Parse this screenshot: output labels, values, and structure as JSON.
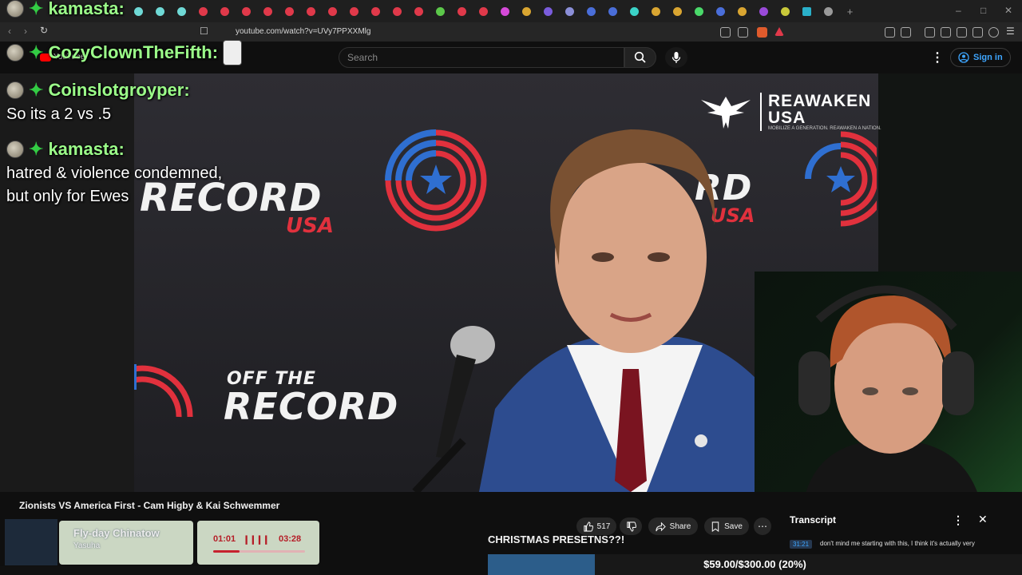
{
  "browser": {
    "url": "youtube.com/watch?v=UVy7PPXXMlg"
  },
  "youtube": {
    "logo_text": "YouTube",
    "search_placeholder": "Search",
    "sign_in_label": "Sign in"
  },
  "video": {
    "title": "Zionists VS America First - Cam Higby & Kai Schwemmer",
    "backdrop_word": "RECORD",
    "backdrop_word_right": "RD",
    "backdrop_usa": "USA",
    "off_the": "OFF THE",
    "off_record": "RECORD",
    "sponsor_name": "REAWAKEN",
    "sponsor_usa": "USA",
    "sponsor_tagline": "MOBILIZE A GENERATION. REAWAKEN A NATION."
  },
  "chat": [
    {
      "user": "kamasta:",
      "message": ""
    },
    {
      "user": "CozyClownTheFifth:",
      "message": ""
    },
    {
      "user": "Coinslotgroyper:",
      "message": "So its a 2 vs .5"
    },
    {
      "user": "kamasta:",
      "message_lines": [
        "hatred & violence condemned,",
        "but only for Ewes"
      ]
    }
  ],
  "actions": {
    "like_count": "517",
    "share_label": "Share",
    "save_label": "Save"
  },
  "music": {
    "title": "Fly-day Chinatow",
    "artist": "Yasuha",
    "elapsed": "01:01",
    "total": "03:28",
    "progress": 0.29
  },
  "stream": {
    "overlay_text": "CHRISTMAS PRESETNS??!",
    "goal_text": "$59.00/$300.00 (20%)",
    "goal_fraction": 0.2
  },
  "transcript": {
    "title": "Transcript",
    "timestamp": "31:21",
    "line": "don't mind me starting with this, I think it's actually very"
  },
  "colors": {
    "youtube_red": "#ff0000",
    "accent_blue": "#3ea6ff",
    "chat_user_green": "#9cff8a",
    "goal_fill": "#2c5d8a",
    "music_red": "#c41f2a"
  }
}
